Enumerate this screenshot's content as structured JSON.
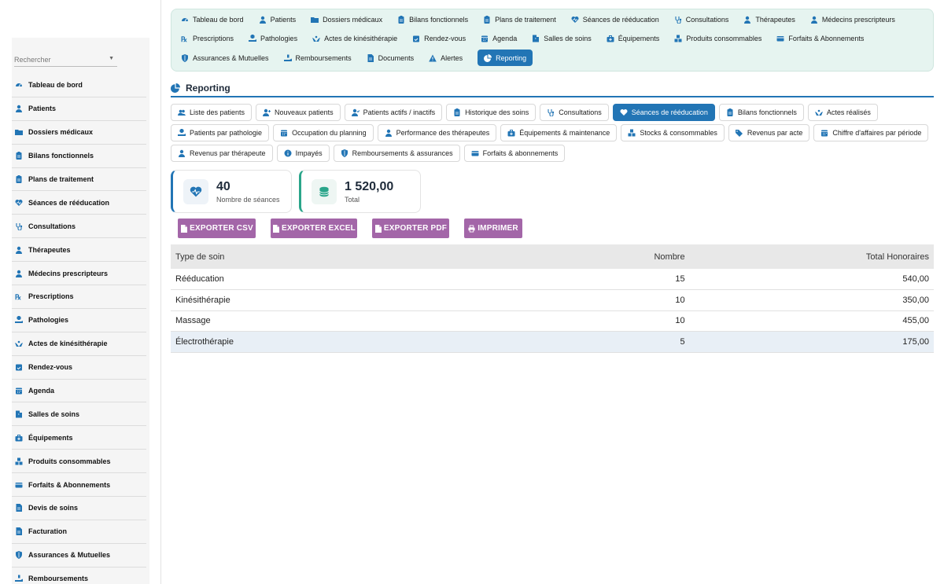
{
  "sidebar": {
    "search_placeholder": "Rechercher",
    "items": [
      {
        "label": "Tableau de bord",
        "icon": "dashboard-icon"
      },
      {
        "label": "Patients",
        "icon": "user-icon"
      },
      {
        "label": "Dossiers médicaux",
        "icon": "folder-icon"
      },
      {
        "label": "Bilans fonctionnels",
        "icon": "clipboard-icon"
      },
      {
        "label": "Plans de traitement",
        "icon": "clipboard-icon"
      },
      {
        "label": "Séances de rééducation",
        "icon": "heart-pulse-icon"
      },
      {
        "label": "Consultations",
        "icon": "stethoscope-icon"
      },
      {
        "label": "Thérapeutes",
        "icon": "user-md-icon"
      },
      {
        "label": "Médecins prescripteurs",
        "icon": "doctor-icon"
      },
      {
        "label": "Prescriptions",
        "icon": "prescription-icon"
      },
      {
        "label": "Pathologies",
        "icon": "hand-holding-medical-icon"
      },
      {
        "label": "Actes de kinésithérapie",
        "icon": "hands-icon"
      },
      {
        "label": "Rendez-vous",
        "icon": "calendar-check-icon"
      },
      {
        "label": "Agenda",
        "icon": "calendar-icon"
      },
      {
        "label": "Salles de soins",
        "icon": "door-icon"
      },
      {
        "label": "Équipements",
        "icon": "toolbox-icon"
      },
      {
        "label": "Produits consommables",
        "icon": "boxes-icon"
      },
      {
        "label": "Forfaits & Abonnements",
        "icon": "card-icon"
      },
      {
        "label": "Devis de soins",
        "icon": "file-invoice-icon"
      },
      {
        "label": "Facturation",
        "icon": "invoice-icon"
      },
      {
        "label": "Assurances & Mutuelles",
        "icon": "shield-icon"
      },
      {
        "label": "Remboursements",
        "icon": "hand-coins-icon"
      }
    ]
  },
  "topnav": {
    "rows": [
      [
        {
          "label": "Tableau de bord",
          "icon": "dashboard-icon"
        },
        {
          "label": "Patients",
          "icon": "user-icon"
        },
        {
          "label": "Dossiers médicaux",
          "icon": "folder-icon"
        },
        {
          "label": "Bilans fonctionnels",
          "icon": "clipboard-icon"
        },
        {
          "label": "Plans de traitement",
          "icon": "clipboard-icon"
        },
        {
          "label": "Séances de rééducation",
          "icon": "heart-pulse-icon"
        },
        {
          "label": "Consultations",
          "icon": "stethoscope-icon"
        },
        {
          "label": "Thérapeutes",
          "icon": "user-md-icon"
        },
        {
          "label": "Médecins prescripteurs",
          "icon": "doctor-icon"
        }
      ],
      [
        {
          "label": "Prescriptions",
          "icon": "prescription-icon"
        },
        {
          "label": "Pathologies",
          "icon": "hand-holding-medical-icon"
        },
        {
          "label": "Actes de kinésithérapie",
          "icon": "hands-icon"
        },
        {
          "label": "Rendez-vous",
          "icon": "calendar-check-icon"
        },
        {
          "label": "Agenda",
          "icon": "calendar-icon"
        },
        {
          "label": "Salles de soins",
          "icon": "door-icon"
        },
        {
          "label": "Équipements",
          "icon": "toolbox-icon"
        },
        {
          "label": "Produits consommables",
          "icon": "boxes-icon"
        },
        {
          "label": "Forfaits & Abonnements",
          "icon": "card-icon"
        }
      ],
      [
        {
          "label": "Assurances & Mutuelles",
          "icon": "shield-icon"
        },
        {
          "label": "Remboursements",
          "icon": "hand-coins-icon"
        },
        {
          "label": "Documents",
          "icon": "file-icon"
        },
        {
          "label": "Alertes",
          "icon": "warning-icon"
        },
        {
          "label": "Reporting",
          "icon": "pie-chart-icon",
          "active": true
        }
      ]
    ]
  },
  "section": {
    "title": "Reporting"
  },
  "report_tabs": {
    "rows": [
      [
        {
          "label": "Liste des patients",
          "icon": "users-icon"
        },
        {
          "label": "Nouveaux patients",
          "icon": "user-plus-icon"
        },
        {
          "label": "Patients actifs / inactifs",
          "icon": "user-check-icon"
        },
        {
          "label": "Historique des soins",
          "icon": "clipboard-icon"
        },
        {
          "label": "Consultations",
          "icon": "stethoscope-icon"
        },
        {
          "label": "Séances de rééducation",
          "icon": "heart-pulse-icon",
          "active": true
        },
        {
          "label": "Bilans fonctionnels",
          "icon": "clipboard-icon"
        },
        {
          "label": "Actes réalisés",
          "icon": "hands-icon"
        }
      ],
      [
        {
          "label": "Patients par pathologie",
          "icon": "hand-holding-medical-icon"
        },
        {
          "label": "Occupation du planning",
          "icon": "calendar-icon"
        },
        {
          "label": "Performance des thérapeutes",
          "icon": "user-md-icon"
        },
        {
          "label": "Équipements & maintenance",
          "icon": "toolbox-icon"
        },
        {
          "label": "Stocks & consommables",
          "icon": "boxes-icon"
        },
        {
          "label": "Revenus par acte",
          "icon": "tags-icon"
        },
        {
          "label": "Chiffre d'affaires par période",
          "icon": "calendar-icon"
        }
      ],
      [
        {
          "label": "Revenus par thérapeute",
          "icon": "user-md-icon"
        },
        {
          "label": "Impayés",
          "icon": "info-icon"
        },
        {
          "label": "Remboursements & assurances",
          "icon": "shield-icon"
        },
        {
          "label": "Forfaits & abonnements",
          "icon": "card-icon"
        }
      ]
    ]
  },
  "kpis": [
    {
      "value": "40",
      "label": "Nombre de séances",
      "icon": "heart-pulse-icon"
    },
    {
      "value": "1 520,00",
      "label": "Total",
      "icon": "coins-icon"
    }
  ],
  "actions": {
    "csv": "EXPORTER CSV",
    "excel": "EXPORTER EXCEL",
    "pdf": "EXPORTER PDF",
    "print": "IMPRIMER"
  },
  "table": {
    "headers": [
      "Type de soin",
      "Nombre",
      "Total Honoraires"
    ],
    "rows": [
      [
        "Rééducation",
        "15",
        "540,00"
      ],
      [
        "Kinésithérapie",
        "10",
        "350,00"
      ],
      [
        "Massage",
        "10",
        "455,00"
      ],
      [
        "Électrothérapie",
        "5",
        "175,00"
      ]
    ]
  },
  "colors": {
    "primary": "#2275b5",
    "accent_green": "#2aa58a",
    "export_button": "#a366a8",
    "nav_bg": "#e6f4f0"
  }
}
